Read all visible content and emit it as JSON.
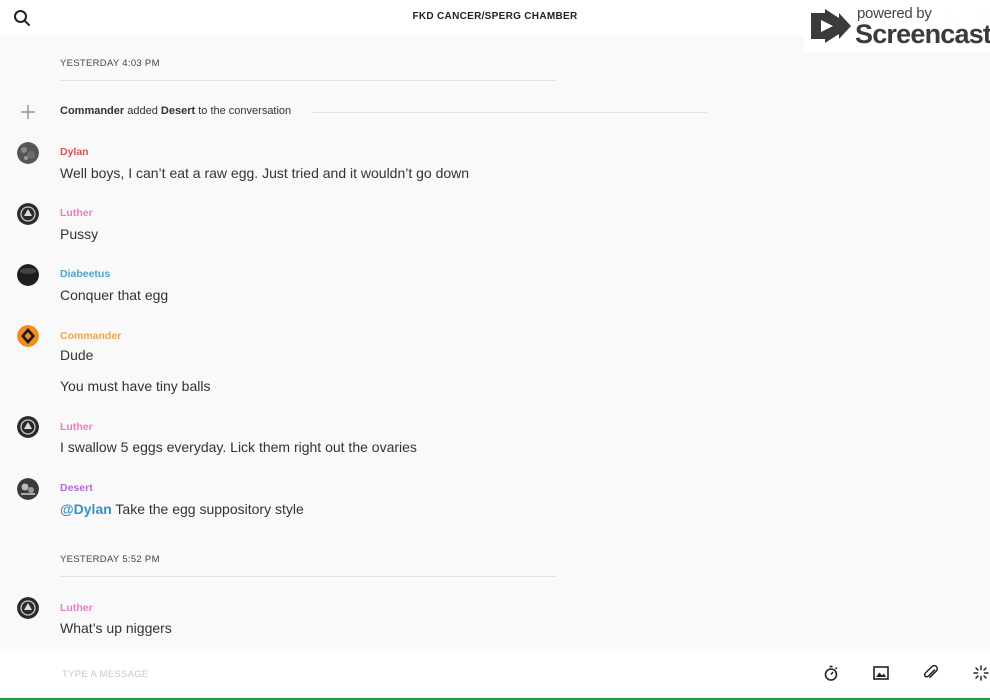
{
  "header": {
    "title": "FKD CANCER/SPERG CHAMBER"
  },
  "watermark": {
    "small": "powered by",
    "big": "Screencastify"
  },
  "timestamps": [
    "YESTERDAY 4:03 PM",
    "YESTERDAY 5:52 PM"
  ],
  "system_event": {
    "actor": "Commander",
    "verb": "added",
    "target": "Desert",
    "suffix": "to the conversation"
  },
  "messages": [
    {
      "author": "Dylan",
      "color": "#d9534f",
      "lines": [
        "Well boys, I can’t eat a raw egg. Just tried and it wouldn’t go down"
      ]
    },
    {
      "author": "Luther",
      "color": "#e87bc8",
      "lines": [
        "Pussy"
      ]
    },
    {
      "author": "Diabeetus",
      "color": "#4ea3c8",
      "lines": [
        "Conquer that egg"
      ]
    },
    {
      "author": "Commander",
      "color": "#f0a24a",
      "lines": [
        "Dude",
        "You must have tiny balls"
      ]
    },
    {
      "author": "Luther",
      "color": "#e87bc8",
      "lines": [
        "I swallow 5 eggs everyday. Lick them right out the ovaries"
      ]
    },
    {
      "author": "Desert",
      "color": "#b36ad6",
      "mention": "@Dylan",
      "lines": [
        "Take the egg suppository style"
      ]
    },
    {
      "author": "Luther",
      "color": "#e87bc8",
      "lines": [
        "What’s up niggers"
      ]
    }
  ],
  "composer": {
    "placeholder": "TYPE A MESSAGE"
  },
  "icons": [
    "search-icon",
    "phone-icon",
    "info-icon",
    "plus-icon",
    "timer-icon",
    "image-icon",
    "paperclip-icon",
    "sparkle-icon"
  ],
  "colors": {
    "mention": "#3a8fc8",
    "background": "#f9f9fa"
  }
}
